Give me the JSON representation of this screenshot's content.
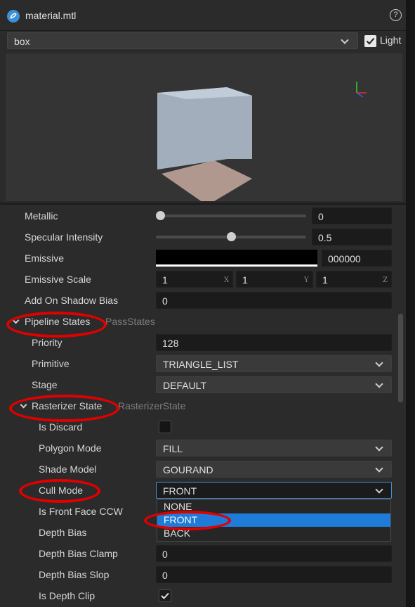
{
  "window": {
    "title": "material.mtl"
  },
  "preview": {
    "mesh": "box",
    "light_label": "Light",
    "light_checked": true
  },
  "props": {
    "metallic": {
      "label": "Metallic",
      "value": "0",
      "fraction": 0.0
    },
    "specular": {
      "label": "Specular Intensity",
      "value": "0.5",
      "fraction": 0.5
    },
    "emissive": {
      "label": "Emissive",
      "hex": "000000",
      "color": "#000000"
    },
    "emissive_scale": {
      "label": "Emissive Scale",
      "x": "1",
      "y": "1",
      "z": "1",
      "axis_x": "X",
      "axis_y": "Y",
      "axis_z": "Z"
    },
    "shadow_bias": {
      "label": "Add On Shadow Bias",
      "value": "0"
    },
    "pipeline": {
      "label": "Pipeline States",
      "sub": "PassStates"
    },
    "priority": {
      "label": "Priority",
      "value": "128"
    },
    "primitive": {
      "label": "Primitive",
      "value": "TRIANGLE_LIST"
    },
    "stage": {
      "label": "Stage",
      "value": "DEFAULT"
    },
    "rasterizer": {
      "label": "Rasterizer State",
      "sub": "RasterizerState"
    },
    "is_discard": {
      "label": "Is Discard",
      "checked": false
    },
    "polygon_mode": {
      "label": "Polygon Mode",
      "value": "FILL"
    },
    "shade_model": {
      "label": "Shade Model",
      "value": "GOURAND"
    },
    "cull_mode": {
      "label": "Cull Mode",
      "value": "FRONT",
      "options": [
        "NONE",
        "FRONT",
        "BACK"
      ],
      "highlighted": "FRONT"
    },
    "front_face": {
      "label": "Is Front Face CCW"
    },
    "depth_bias": {
      "label": "Depth Bias"
    },
    "depth_bias_clamp": {
      "label": "Depth Bias Clamp",
      "value": "0"
    },
    "depth_bias_slop": {
      "label": "Depth Bias Slop",
      "value": "0"
    },
    "depth_clip": {
      "label": "Is Depth Clip",
      "checked": true
    }
  },
  "colors": {
    "accent": "#1e7bd8",
    "annotation": "#e00000"
  },
  "icons": {
    "app": "engine-logo-icon",
    "help": "help-icon",
    "check": "checkmark-icon",
    "chevron": "chevron-down-icon",
    "collapse": "chevron-down-icon"
  }
}
